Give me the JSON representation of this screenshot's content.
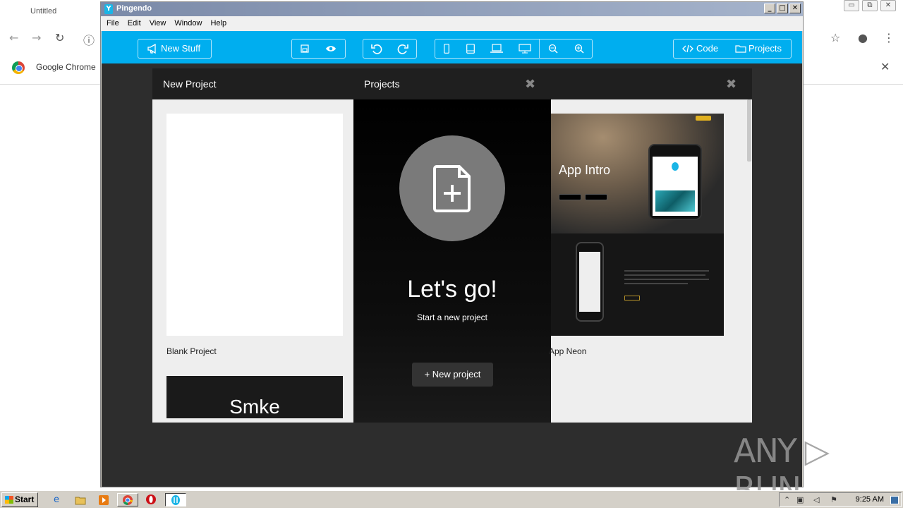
{
  "chrome": {
    "tab_title": "Untitled",
    "bookmark_label": "Google Chrome",
    "win_minimize": "▭",
    "win_restore": "⧉",
    "win_close": "✕",
    "back_glyph": "←",
    "forward_glyph": "→",
    "reload_glyph": "↻",
    "info_glyph": "ⓘ",
    "star_glyph": "☆",
    "account_glyph": "●",
    "menu_glyph": "⋮",
    "bookmark_close": "✕"
  },
  "pingendo": {
    "title": "Pingendo",
    "title_icon": "Y",
    "win_buttons": [
      "_",
      "□",
      "✕"
    ],
    "menu": [
      "File",
      "Edit",
      "View",
      "Window",
      "Help"
    ],
    "toolbar": {
      "new_stuff": "New Stuff",
      "new_stuff_icon": "megaphone-icon",
      "save_icon": "floppy-icon",
      "preview_icon": "eye-icon",
      "undo_icon": "undo-icon",
      "redo_icon": "redo-icon",
      "device_icons": [
        "phone-icon",
        "tablet-icon",
        "laptop-icon",
        "desktop-icon",
        "zoom-out-icon",
        "zoom-in-icon"
      ],
      "code": "Code",
      "projects": "Projects"
    },
    "accent": "#00aeef"
  },
  "modal": {
    "new_project_header": "New Project",
    "projects_header": "Projects",
    "close_glyph": "✖",
    "blank_label": "Blank Project",
    "smke_text": "Smke",
    "letsgo_title": "Let's go!",
    "letsgo_sub": "Start a new project",
    "new_project_button": "+ New project",
    "neon_label": "App Neon",
    "neon_preview_title": "App Intro"
  },
  "watermark": "ANY ▷ RUN",
  "taskbar": {
    "start": "Start",
    "clock": "9:25 AM",
    "tasks": [
      "ie-icon",
      "explorer-icon",
      "media-player-icon",
      "chrome-icon",
      "opera-icon",
      "pingendo-icon"
    ]
  }
}
